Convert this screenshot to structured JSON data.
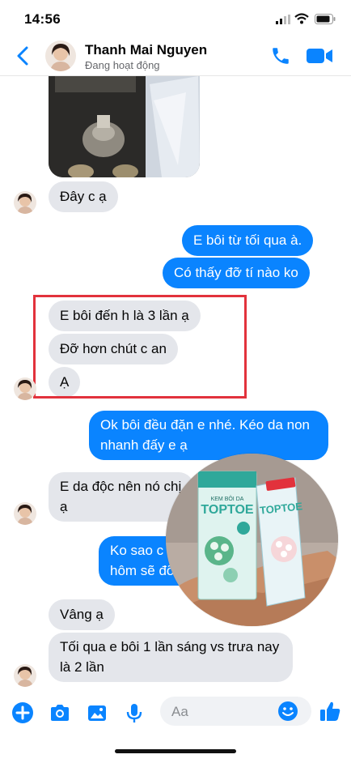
{
  "status_bar": {
    "time": "14:56"
  },
  "header": {
    "name": "Thanh Mai Nguyen",
    "status": "Đang hoạt động"
  },
  "messages": [
    {
      "from": "contact",
      "text": "Đây c ạ"
    },
    {
      "from": "me",
      "text": "E bôi từ tối qua à."
    },
    {
      "from": "me",
      "text": "Có thấy đỡ tí nào ko"
    },
    {
      "from": "contact",
      "text": "E bôi đến h là 3 lần ạ"
    },
    {
      "from": "contact",
      "text": "Đỡ hơn chút c an"
    },
    {
      "from": "contact",
      "text": "Ạ"
    },
    {
      "from": "me",
      "text": "Ok bôi đều đặn e nhé. Kéo da non nhanh đấy e ạ"
    },
    {
      "from": "contact",
      "text": "E da độc nên nó chị ạ"
    },
    {
      "from": "me",
      "text": "Ko sao c hôm sẽ đỡ"
    },
    {
      "from": "contact",
      "text": "Vâng ạ"
    },
    {
      "from": "contact",
      "text": "Tối qua e bôi 1 lần sáng vs trưa nay là 2 lần"
    }
  ],
  "product": {
    "brand": "TOPTOE",
    "caption": "KEM BÔI DA"
  },
  "composer": {
    "placeholder": "Aa"
  },
  "colors": {
    "accent": "#0a84ff",
    "highlight": "#e2323c",
    "incoming_bubble": "#e4e6eb"
  },
  "icons": [
    "back-icon",
    "phone-icon",
    "video-icon",
    "plus-icon",
    "camera-icon",
    "image-icon",
    "microphone-icon",
    "emoji-icon",
    "like-icon"
  ]
}
